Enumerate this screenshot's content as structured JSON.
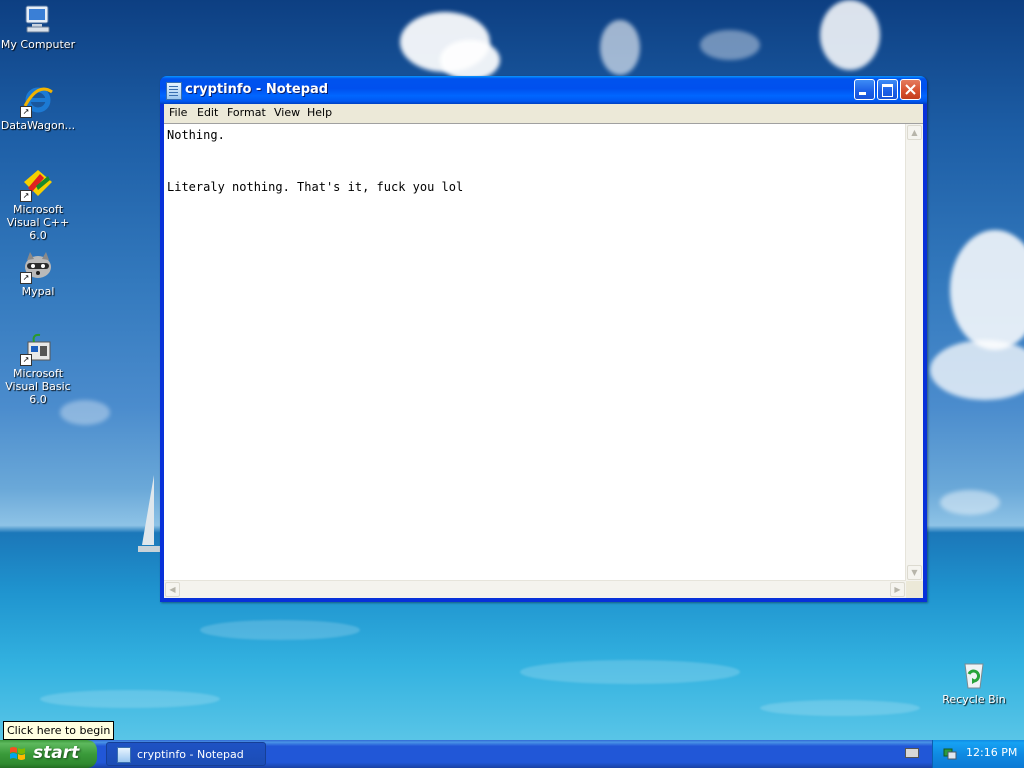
{
  "desktop": {
    "icons": [
      {
        "label": "My Computer",
        "icon": "my-computer-icon"
      },
      {
        "label": "DataWagon...",
        "icon": "internet-explorer-icon"
      },
      {
        "label": "Microsoft Visual C++ 6.0",
        "icon": "visual-cpp-icon"
      },
      {
        "label": "Mypal",
        "icon": "mypal-raccoon-icon"
      },
      {
        "label": "Microsoft Visual Basic 6.0",
        "icon": "visual-basic-icon"
      },
      {
        "label": "Recycle Bin",
        "icon": "recycle-bin-icon"
      }
    ]
  },
  "window": {
    "title": "cryptinfo - Notepad",
    "menu": [
      "File",
      "Edit",
      "Format",
      "View",
      "Help"
    ],
    "lines": [
      "Nothing.",
      "",
      "",
      "Literaly nothing. That's it, fuck you lol"
    ]
  },
  "tooltip": "Click here to begin",
  "taskbar": {
    "start_label": "start",
    "tasks": [
      {
        "label": "cryptinfo - Notepad"
      }
    ],
    "clock": "12:16 PM"
  },
  "colors": {
    "title_bar": "#0058ee",
    "start_button": "#3a9a3a",
    "taskbar": "#2157d7",
    "tray": "#0f8be3"
  }
}
